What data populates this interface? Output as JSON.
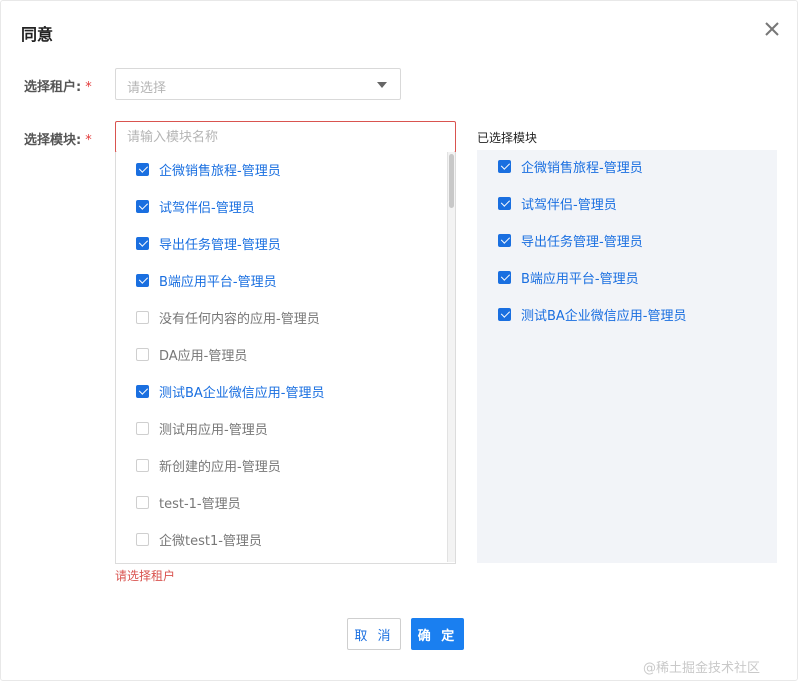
{
  "dialog": {
    "title": "同意",
    "close_icon": "close-icon"
  },
  "tenant": {
    "label": "选择租户:",
    "required_mark": "*",
    "placeholder": "请选择",
    "caret_icon": "caret-down-icon"
  },
  "module": {
    "label": "选择模块:",
    "required_mark": "*",
    "search_placeholder": "请输入模块名称",
    "error": "请选择租户",
    "options": [
      {
        "label": "企微销售旅程-管理员",
        "checked": true
      },
      {
        "label": "试驾伴侣-管理员",
        "checked": true
      },
      {
        "label": "导出任务管理-管理员",
        "checked": true
      },
      {
        "label": "B端应用平台-管理员",
        "checked": true
      },
      {
        "label": "没有任何内容的应用-管理员",
        "checked": false
      },
      {
        "label": "DA应用-管理员",
        "checked": false
      },
      {
        "label": "测试BA企业微信应用-管理员",
        "checked": true
      },
      {
        "label": "测试用应用-管理员",
        "checked": false
      },
      {
        "label": "新创建的应用-管理员",
        "checked": false
      },
      {
        "label": "test-1-管理员",
        "checked": false
      },
      {
        "label": "企微test1-管理员",
        "checked": false
      }
    ]
  },
  "selected": {
    "title": "已选择模块",
    "items": [
      {
        "label": "企微销售旅程-管理员"
      },
      {
        "label": "试驾伴侣-管理员"
      },
      {
        "label": "导出任务管理-管理员"
      },
      {
        "label": "B端应用平台-管理员"
      },
      {
        "label": "测试BA企业微信应用-管理员"
      }
    ]
  },
  "footer": {
    "cancel_label": "取 消",
    "ok_label": "确 定"
  },
  "watermark": "@稀土掘金技术社区",
  "colors": {
    "accent": "#1a6fe0",
    "error": "#d9534f",
    "panel_bg": "#f2f4f8"
  }
}
